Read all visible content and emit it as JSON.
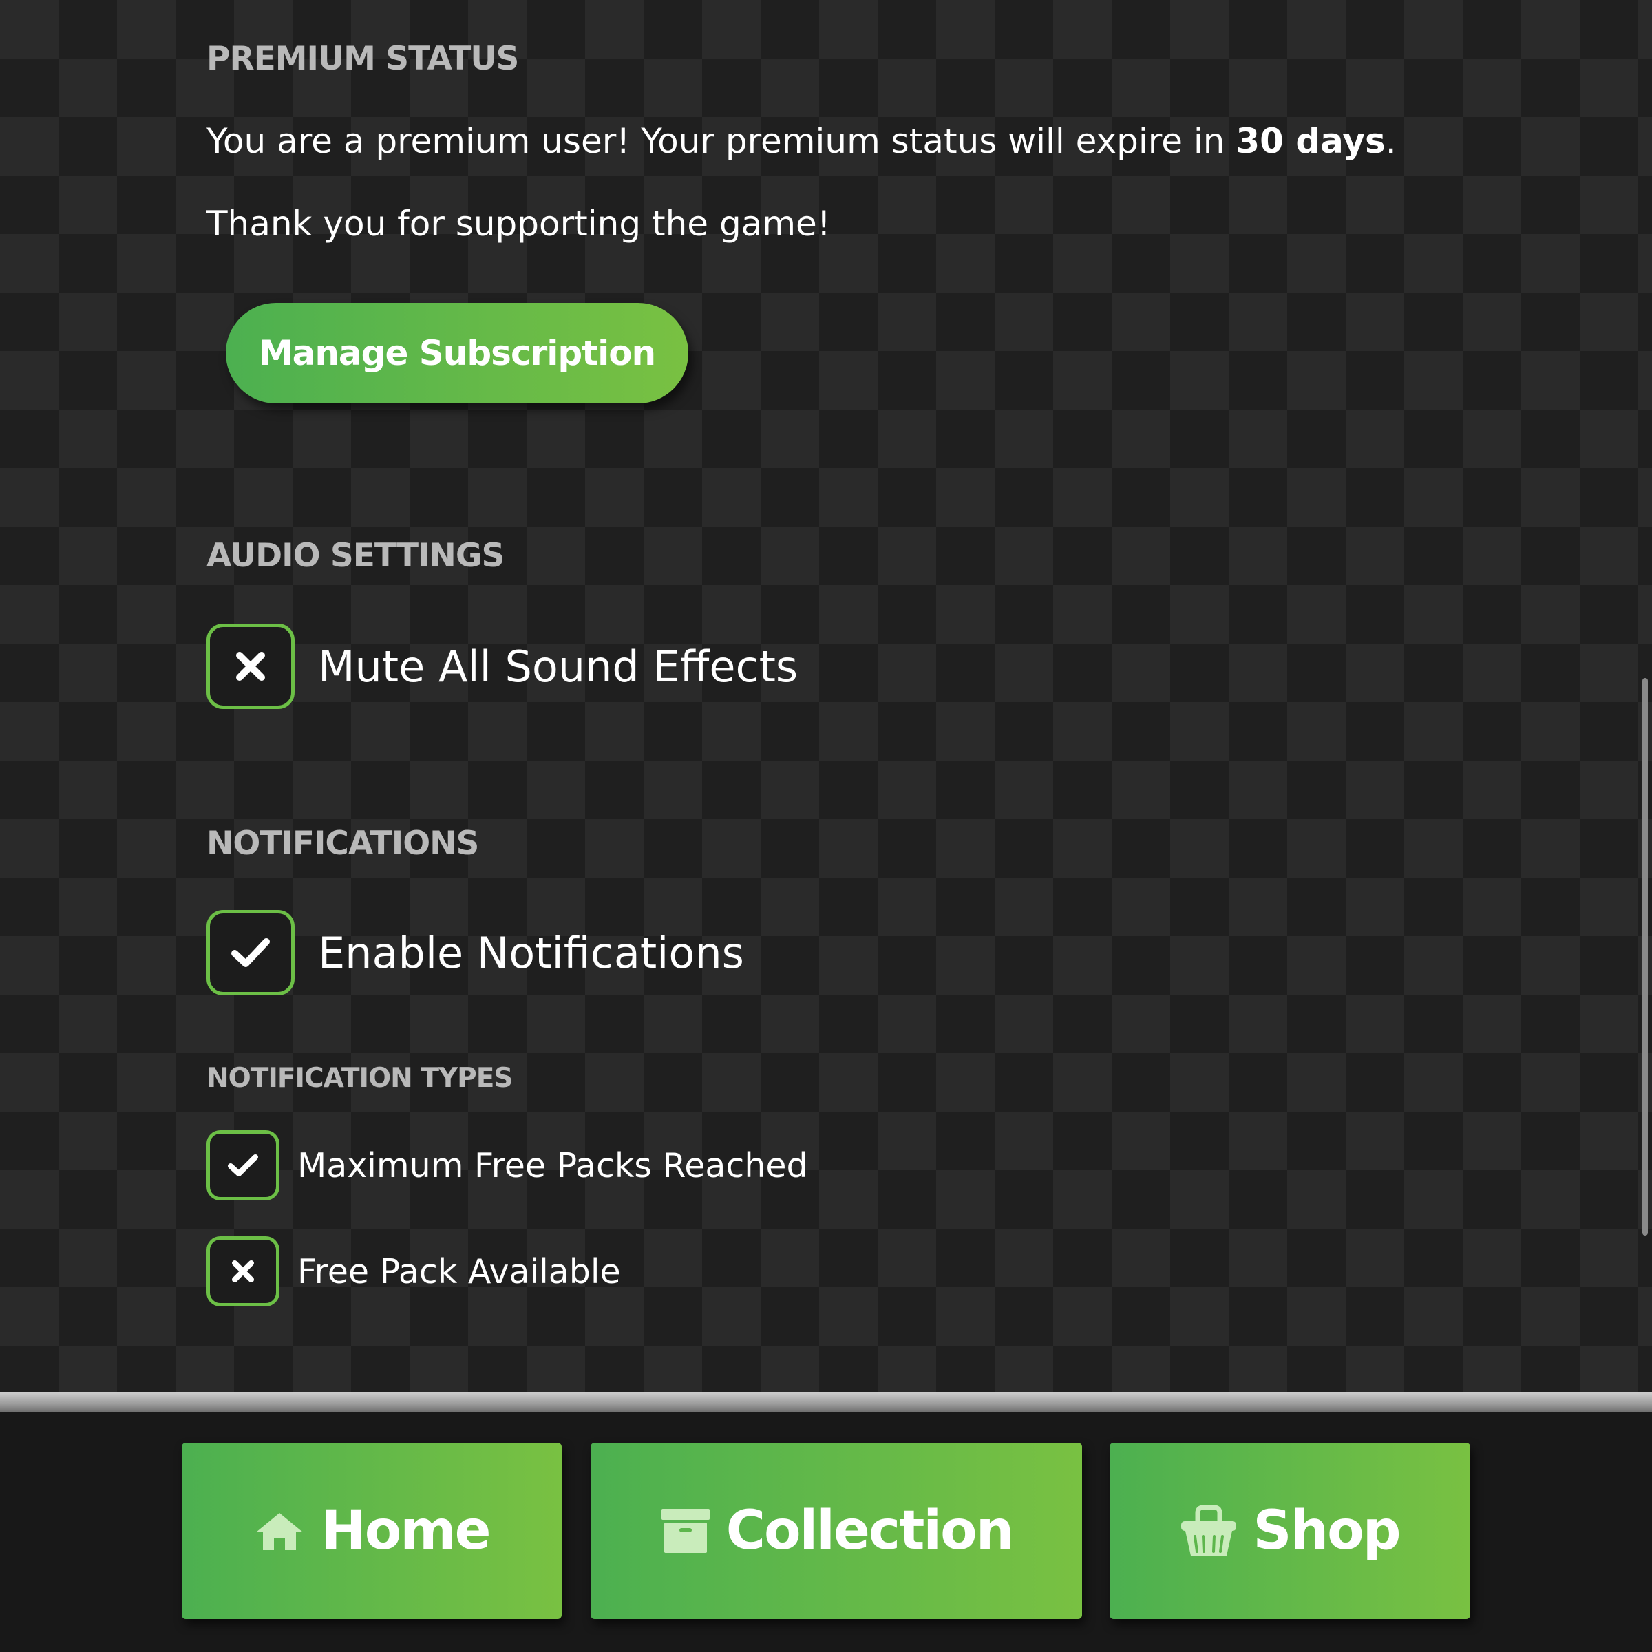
{
  "premium": {
    "title": "PREMIUM STATUS",
    "message_prefix": "You are a premium user! Your premium status will expire in ",
    "message_days": "30 days",
    "message_suffix": ".",
    "thanks": "Thank you for supporting the game!",
    "manage_label": "Manage Subscription"
  },
  "audio": {
    "title": "AUDIO SETTINGS",
    "mute_label": "Mute All Sound Effects",
    "mute_state": "x-mark"
  },
  "notifications": {
    "title": "NOTIFICATIONS",
    "enable_label": "Enable Notifications",
    "enable_state": "check",
    "types_title": "NOTIFICATION TYPES",
    "types": [
      {
        "label": "Maximum Free Packs Reached",
        "state": "check"
      },
      {
        "label": "Free Pack Available",
        "state": "x-mark"
      }
    ]
  },
  "nav": {
    "home": {
      "label": "Home",
      "icon": "home-icon"
    },
    "collection": {
      "label": "Collection",
      "icon": "archive-box-icon"
    },
    "shop": {
      "label": "Shop",
      "icon": "shopping-basket-icon"
    }
  },
  "colors": {
    "accent_green": "#6cbf46",
    "button_gradient_start": "#4cb050",
    "button_gradient_end": "#79c142",
    "section_title": "#b9b9b9",
    "background_dark": "#1f1f1f",
    "background_light": "#2a2a2a"
  }
}
